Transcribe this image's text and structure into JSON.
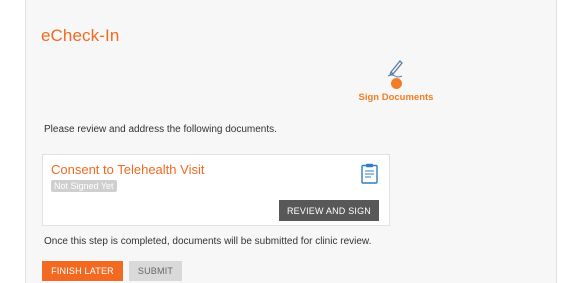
{
  "app": {
    "title": "eCheck-In"
  },
  "step": {
    "label": "Sign Documents",
    "icon": "pen-icon"
  },
  "instructions": "Please review and address the following documents.",
  "document": {
    "title": "Consent to Telehealth Visit",
    "status": "Not Signed Yet",
    "icon": "clipboard-icon",
    "action_label": "REVIEW AND SIGN"
  },
  "note": "Once this step is completed, documents will be submitted for clinic review.",
  "actions": {
    "finish_later": "FINISH LATER",
    "submit": "SUBMIT"
  },
  "colors": {
    "accent": "#f26a21",
    "dark_button": "#585858",
    "disabled_button": "#d9d9d9",
    "status_badge": "#cfcfcf",
    "icon_blue": "#2d7fc1"
  }
}
